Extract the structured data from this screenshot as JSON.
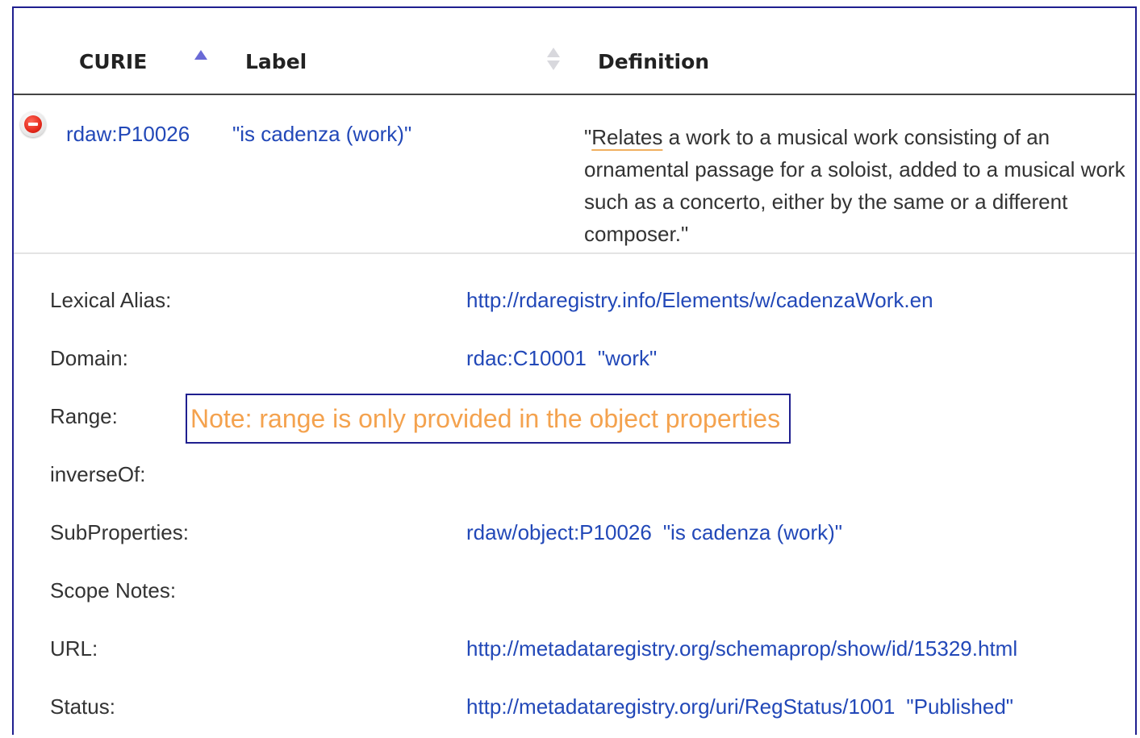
{
  "table": {
    "headers": {
      "curie": "CURIE",
      "label": "Label",
      "definition": "Definition"
    },
    "sort": {
      "curie": "ascending",
      "label": "sortable"
    }
  },
  "row": {
    "curie": "rdaw:P10026",
    "label": "\"is cadenza (work)\"",
    "definition_prefix": "\"",
    "definition_underlined": "Relates",
    "definition_rest": " a work to a musical work consisting of an ornamental passage for a soloist, added to a musical work such as a concerto, either by the same or a different composer.\""
  },
  "details": {
    "lexical_alias": {
      "label": "Lexical Alias:",
      "value": "http://rdaregistry.info/Elements/w/cadenzaWork.en"
    },
    "domain": {
      "label": "Domain:",
      "curie": "rdac:C10001",
      "name": "\"work\""
    },
    "range": {
      "label": "Range:"
    },
    "inverse_of": {
      "label": "inverseOf:"
    },
    "sub_properties": {
      "label": "SubProperties:",
      "curie": "rdaw/object:P10026",
      "name": "\"is cadenza (work)\""
    },
    "scope_notes": {
      "label": "Scope Notes:"
    },
    "url": {
      "label": "URL:",
      "value": "http://metadataregistry.org/schemaprop/show/id/15329.html"
    },
    "status": {
      "label": "Status:",
      "uri": "http://metadataregistry.org/uri/RegStatus/1001",
      "name": "\"Published\""
    }
  },
  "note": {
    "text": "Note: range is only provided in the object properties"
  },
  "colors": {
    "link": "#2248b8",
    "text": "#333333",
    "note": "#f4a24e",
    "border": "#1f1f8f",
    "remove": "#e52a1c"
  },
  "icons": {
    "remove": "remove-circle-icon",
    "sort_asc": "sort-ascending-icon",
    "sort_both": "sort-both-icon"
  }
}
